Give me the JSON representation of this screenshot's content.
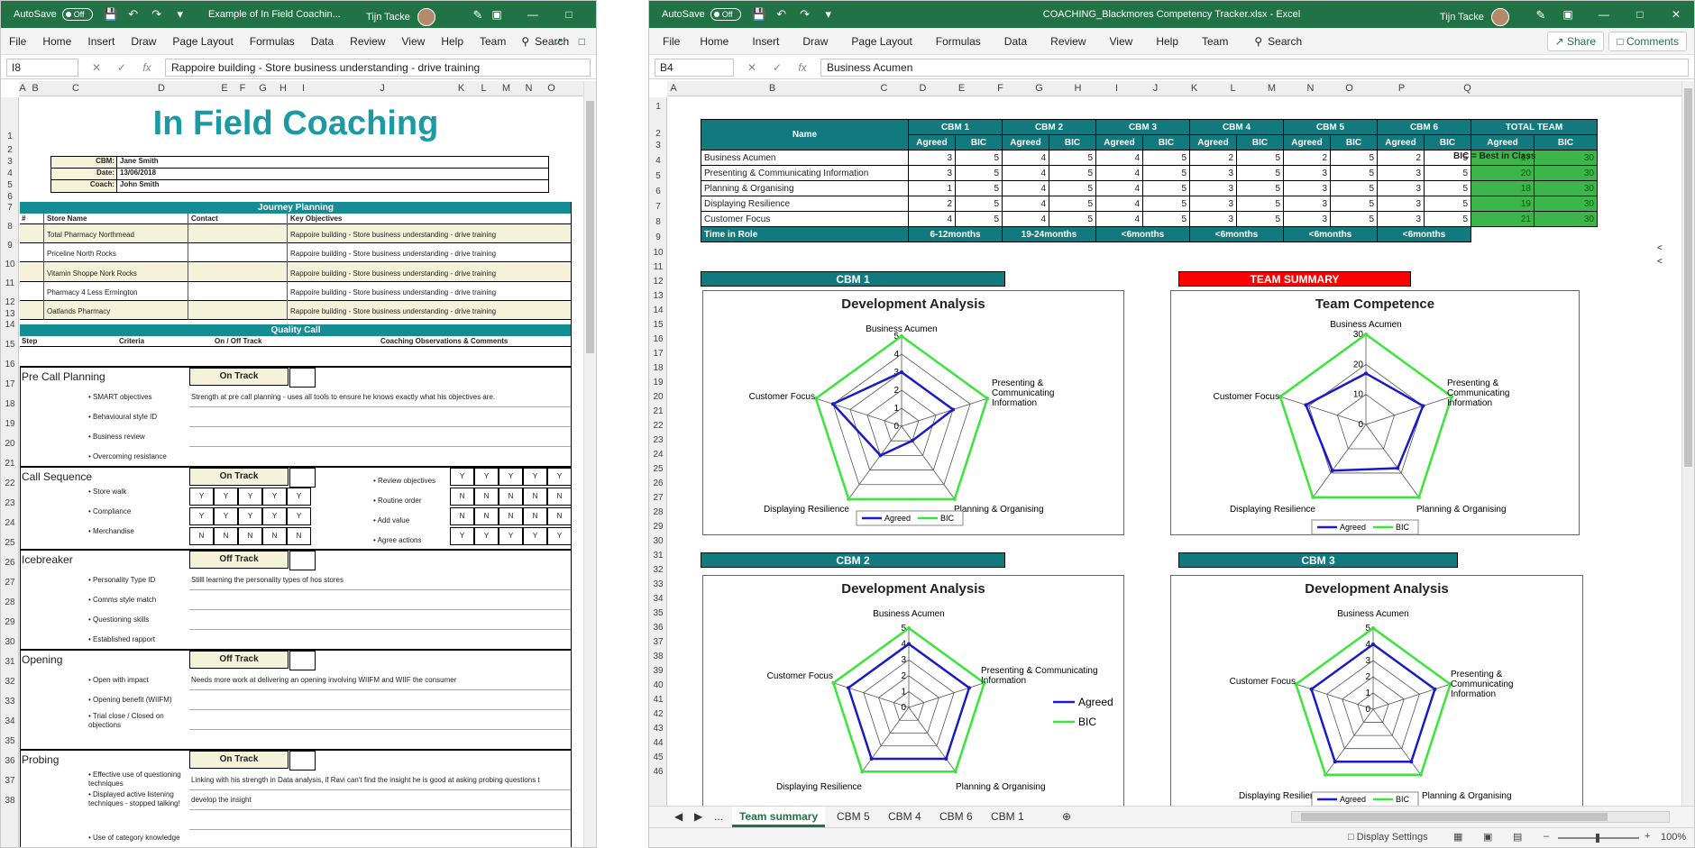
{
  "left": {
    "title": "Example of In Field Coachin...",
    "autosave": "AutoSave",
    "toggle": "Off",
    "user": "Tijn Tacke",
    "menu": [
      "File",
      "Home",
      "Insert",
      "Draw",
      "Page Layout",
      "Formulas",
      "Data",
      "Review",
      "View",
      "Help",
      "Team"
    ],
    "search": "Search",
    "namebox": "I8",
    "formula": "Rappoire building - Store business understanding - drive training",
    "columns": [
      "A",
      "B",
      "C",
      "D",
      "E",
      "F",
      "G",
      "H",
      "I",
      "J",
      "K",
      "L",
      "M",
      "N",
      "O"
    ],
    "rows": [
      "1",
      "2",
      "3",
      "4",
      "5",
      "6",
      "7",
      "8",
      "9",
      "10",
      "11",
      "12",
      "13",
      "14",
      "15",
      "16",
      "17",
      "18",
      "19",
      "20",
      "21",
      "22",
      "23",
      "24",
      "25",
      "26",
      "27",
      "28",
      "29",
      "30",
      "31",
      "32",
      "33",
      "34",
      "35",
      "36",
      "37",
      "38"
    ],
    "sheet_title": "In Field Coaching",
    "info": [
      {
        "label": "CBM:",
        "value": "Jane Smith"
      },
      {
        "label": "Date:",
        "value": "13/06/2018"
      },
      {
        "label": "Coach:",
        "value": "John Smith"
      }
    ],
    "journey_bar": "Journey Planning",
    "journey_headers": {
      "num": "#",
      "store": "Store Name",
      "contact": "Contact",
      "obj": "Key Objectives"
    },
    "journey_rows": [
      {
        "store": "Total Pharmacy Northmead",
        "obj": "Rappoire building - Store business understanding - drive training"
      },
      {
        "store": "Priceline North Rocks",
        "obj": "Rappoire building - Store business understanding - drive training"
      },
      {
        "store": "Vitamin Shoppe Nork Rocks",
        "obj": "Rappoire building - Store business understanding - drive training"
      },
      {
        "store": "Pharmacy 4 Less Ermington",
        "obj": "Rappoire building - Store business understanding - drive training"
      },
      {
        "store": "Oatlands Pharmacy",
        "obj": "Rappoire building - Store business understanding - drive training"
      }
    ],
    "quality_bar": "Quality Call",
    "quality_headers": {
      "step": "Step",
      "criteria": "Criteria",
      "track": "On / Off Track",
      "obs": "Coaching Observations & Comments"
    },
    "sections": [
      {
        "name": "Pre Call Planning",
        "track": "On Track",
        "criteria": [
          "• SMART objectives",
          "• Behavioural style ID",
          "• Business review",
          "• Overcoming resistance"
        ],
        "obs": "Strength at pre call planning - uses all tools to ensure he knows exactly what his objectives are."
      },
      {
        "name": "Call Sequence",
        "track": "On Track",
        "criteria": [
          "• Store walk",
          "• Compliance",
          "• Merchandise"
        ],
        "obs": "",
        "right_criteria": [
          "• Review objectives",
          "• Routine order",
          "• Add value",
          "• Agree actions"
        ]
      },
      {
        "name": "Icebreaker",
        "track": "Off Track",
        "criteria": [
          "• Personality Type ID",
          "• Comms style match",
          "• Questioning skills",
          "• Established rapport"
        ],
        "obs": "Stilll learning the personality types of hos stores"
      },
      {
        "name": "Opening",
        "track": "Off Track",
        "criteria": [
          "• Open with impact",
          "• Opening benefit (WIIFM)",
          "• Trial close / Closed on objections"
        ],
        "obs": "Needs more work at delivering an opening involving WIIFM and WIIF the consumer"
      },
      {
        "name": "Probing",
        "track": "On Track",
        "criteria": [
          "• Effective use of questioning techniques",
          "• Displayed active listening techniques  - stopped talking!",
          "• Use of category knowledge"
        ],
        "obs": "Linking with his strength in Data analysis, if Ravi can't find the insight he is good at asking probing questions t",
        "obs2": "develop the insight"
      }
    ],
    "yn_left": [
      [
        "Y",
        "Y",
        "Y",
        "Y",
        "Y"
      ],
      [
        "Y",
        "Y",
        "Y",
        "Y",
        "Y"
      ],
      [
        "N",
        "N",
        "N",
        "N",
        "N"
      ]
    ],
    "yn_right": [
      [
        "Y",
        "Y",
        "Y",
        "Y",
        "Y"
      ],
      [
        "N",
        "N",
        "N",
        "N",
        "N"
      ],
      [
        "N",
        "N",
        "N",
        "N",
        "N"
      ],
      [
        "Y",
        "Y",
        "Y",
        "Y",
        "Y"
      ]
    ]
  },
  "right": {
    "title": "COACHING_Blackmores Competency Tracker.xlsx  -  Excel",
    "autosave": "AutoSave",
    "toggle": "Off",
    "user": "Tijn Tacke",
    "menu": [
      "File",
      "Home",
      "Insert",
      "Draw",
      "Page Layout",
      "Formulas",
      "Data",
      "Review",
      "View",
      "Help",
      "Team"
    ],
    "search": "Search",
    "share": "Share",
    "comments": "Comments",
    "namebox": "B4",
    "formula": "Business Acumen",
    "columns": [
      "A",
      "B",
      "C",
      "D",
      "E",
      "F",
      "G",
      "H",
      "I",
      "J",
      "K",
      "L",
      "M",
      "N",
      "O",
      "P",
      "Q"
    ],
    "rows": [
      "1",
      "2",
      "3",
      "4",
      "5",
      "6",
      "7",
      "8",
      "9",
      "10",
      "11",
      "12",
      "13",
      "14",
      "15",
      "16",
      "17",
      "18",
      "19",
      "20",
      "21",
      "22",
      "23",
      "24",
      "25",
      "26",
      "27",
      "28",
      "29",
      "30",
      "31",
      "32",
      "33",
      "34",
      "35",
      "36",
      "37",
      "38",
      "39",
      "40",
      "41",
      "42",
      "43",
      "44",
      "45",
      "46"
    ],
    "table": {
      "name_header": "Name",
      "groups": [
        "CBM 1",
        "CBM 2",
        "CBM 3",
        "CBM 4",
        "CBM 5",
        "CBM 6",
        "TOTAL TEAM"
      ],
      "sub": [
        "Agreed",
        "BIC"
      ],
      "rows": [
        {
          "name": "Business Acumen",
          "values": [
            3,
            5,
            4,
            5,
            4,
            5,
            2,
            5,
            2,
            5,
            2,
            5,
            17,
            30
          ]
        },
        {
          "name": "Presenting & Communicating Information",
          "values": [
            3,
            5,
            4,
            5,
            4,
            5,
            3,
            5,
            3,
            5,
            3,
            5,
            20,
            30
          ]
        },
        {
          "name": "Planning & Organising",
          "values": [
            1,
            5,
            4,
            5,
            4,
            5,
            3,
            5,
            3,
            5,
            3,
            5,
            18,
            30
          ]
        },
        {
          "name": "Displaying Resilience",
          "values": [
            2,
            5,
            4,
            5,
            4,
            5,
            3,
            5,
            3,
            5,
            3,
            5,
            19,
            30
          ]
        },
        {
          "name": "Customer Focus",
          "values": [
            4,
            5,
            4,
            5,
            4,
            5,
            3,
            5,
            3,
            5,
            3,
            5,
            21,
            30
          ]
        }
      ],
      "time_label": "Time in Role",
      "time_values": [
        "6-12months",
        "19-24months",
        "<6months",
        "<6months",
        "<6months",
        "<6months"
      ],
      "note": "BIC = Best in Class"
    },
    "section_labels": {
      "cbm1": "CBM 1",
      "team": "TEAM SUMMARY",
      "cbm2": "CBM 2",
      "cbm3": "CBM 3"
    },
    "tabs": [
      "Team summary",
      "CBM 5",
      "CBM 4",
      "CBM 6",
      "CBM 1"
    ],
    "tab_more": "...",
    "status": {
      "display": "Display Settings",
      "zoom": "100%"
    }
  },
  "chart_data": [
    {
      "type": "radar",
      "title": "Development Analysis",
      "categories": [
        "Business Acumen",
        "Presenting & Communicating Information",
        "Planning & Organising",
        "Displaying Resilience",
        "Customer Focus"
      ],
      "series": [
        {
          "name": "Agreed",
          "values": [
            3,
            3,
            1,
            2,
            4
          ]
        },
        {
          "name": "BIC",
          "values": [
            5,
            5,
            5,
            5,
            5
          ]
        }
      ],
      "rlim": [
        0,
        5
      ],
      "ticks": [
        "0",
        "1",
        "2",
        "3",
        "4",
        "5"
      ],
      "legend": "bottom"
    },
    {
      "type": "radar",
      "title": "Team Competence",
      "categories": [
        "Business Acumen",
        "Presenting & Communicating Information",
        "Planning & Organising",
        "Displaying Resilience",
        "Customer Focus"
      ],
      "series": [
        {
          "name": "Agreed",
          "values": [
            17,
            20,
            18,
            19,
            21
          ]
        },
        {
          "name": "BIC",
          "values": [
            30,
            30,
            30,
            30,
            30
          ]
        }
      ],
      "rlim": [
        0,
        30
      ],
      "ticks": [
        "0",
        "10",
        "20",
        "30"
      ],
      "legend": "bottom"
    },
    {
      "type": "radar",
      "title": "Development Analysis",
      "categories": [
        "Business Acumen",
        "Presenting & Communicating Information",
        "Planning & Organising",
        "Displaying Resilience",
        "Customer Focus"
      ],
      "series": [
        {
          "name": "Agreed",
          "values": [
            4,
            4,
            4,
            4,
            4
          ]
        },
        {
          "name": "BIC",
          "values": [
            5,
            5,
            5,
            5,
            5
          ]
        }
      ],
      "rlim": [
        0,
        5
      ],
      "ticks": [
        "0",
        "1",
        "2",
        "3",
        "4",
        "5"
      ],
      "legend": "right"
    },
    {
      "type": "radar",
      "title": "Development Analysis",
      "categories": [
        "Business Acumen",
        "Presenting & Communicating Information",
        "Planning & Organising",
        "Displaying Resilience",
        "Customer Focus"
      ],
      "series": [
        {
          "name": "Agreed",
          "values": [
            4,
            4,
            4,
            4,
            4
          ]
        },
        {
          "name": "BIC",
          "values": [
            5,
            5,
            5,
            5,
            5
          ]
        }
      ],
      "rlim": [
        0,
        5
      ],
      "ticks": [
        "0",
        "1",
        "2",
        "3",
        "4",
        "5"
      ],
      "legend": "bottom"
    }
  ],
  "colors": {
    "excel_green": "#217346",
    "teal": "#138c94",
    "agreed": "#1a1ac8",
    "bic": "#39e639",
    "red": "#ff0000",
    "cell_green": "#3cb54a"
  }
}
